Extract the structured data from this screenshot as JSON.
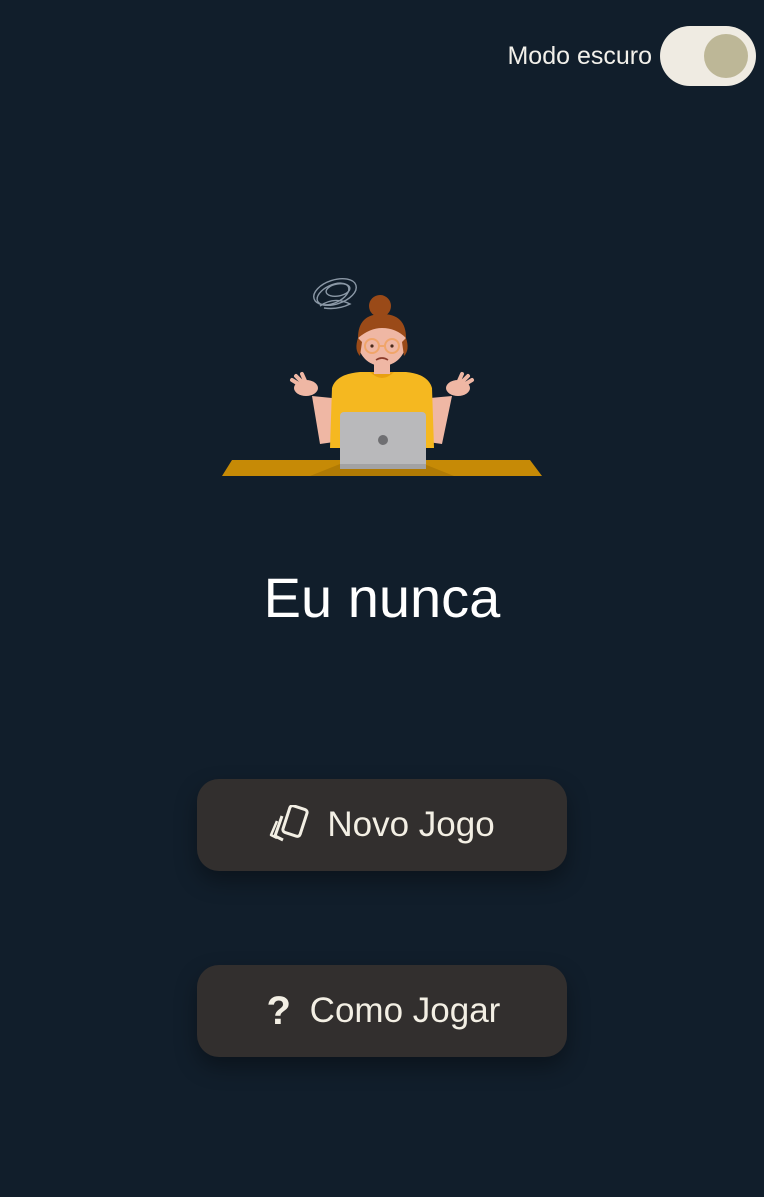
{
  "header": {
    "dark_mode_label": "Modo escuro",
    "dark_mode_enabled": true
  },
  "illustration": {
    "name": "confused-woman-at-laptop-illustration"
  },
  "main": {
    "title": "Eu nunca"
  },
  "buttons": {
    "new_game": {
      "label": "Novo Jogo",
      "icon": "cards-icon"
    },
    "how_to_play": {
      "label": "Como Jogar",
      "icon": "question-mark-icon"
    }
  },
  "colors": {
    "background": "#111e2b",
    "button_bg": "#322f2e",
    "button_text": "#f3efe4",
    "toggle_track": "#efebe2",
    "toggle_knob": "#bdb797",
    "accent_yellow": "#f5b820",
    "desk": "#c68a06"
  }
}
